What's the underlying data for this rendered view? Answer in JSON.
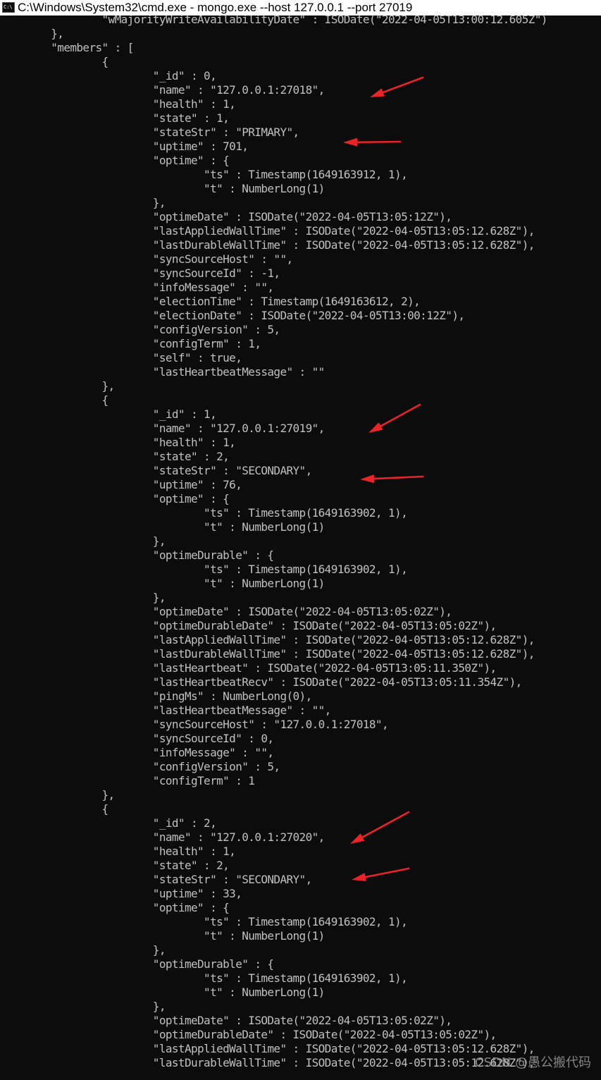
{
  "window": {
    "title": "C:\\Windows\\System32\\cmd.exe - mongo.exe  --host 127.0.0.1 --port 27019",
    "icon": "cmd-icon",
    "icon_text": "C:\\"
  },
  "console": {
    "lines": [
      "                \"wMajorityWriteAvailabilityDate\" : ISODate(\"2022-04-05T13:00:12.605Z\")",
      "        },",
      "        \"members\" : [",
      "                {",
      "                        \"_id\" : 0,",
      "                        \"name\" : \"127.0.0.1:27018\",",
      "                        \"health\" : 1,",
      "                        \"state\" : 1,",
      "                        \"stateStr\" : \"PRIMARY\",",
      "                        \"uptime\" : 701,",
      "                        \"optime\" : {",
      "                                \"ts\" : Timestamp(1649163912, 1),",
      "                                \"t\" : NumberLong(1)",
      "                        },",
      "                        \"optimeDate\" : ISODate(\"2022-04-05T13:05:12Z\"),",
      "                        \"lastAppliedWallTime\" : ISODate(\"2022-04-05T13:05:12.628Z\"),",
      "                        \"lastDurableWallTime\" : ISODate(\"2022-04-05T13:05:12.628Z\"),",
      "                        \"syncSourceHost\" : \"\",",
      "                        \"syncSourceId\" : -1,",
      "                        \"infoMessage\" : \"\",",
      "                        \"electionTime\" : Timestamp(1649163612, 2),",
      "                        \"electionDate\" : ISODate(\"2022-04-05T13:00:12Z\"),",
      "                        \"configVersion\" : 5,",
      "                        \"configTerm\" : 1,",
      "                        \"self\" : true,",
      "                        \"lastHeartbeatMessage\" : \"\"",
      "                },",
      "                {",
      "                        \"_id\" : 1,",
      "                        \"name\" : \"127.0.0.1:27019\",",
      "                        \"health\" : 1,",
      "                        \"state\" : 2,",
      "                        \"stateStr\" : \"SECONDARY\",",
      "                        \"uptime\" : 76,",
      "                        \"optime\" : {",
      "                                \"ts\" : Timestamp(1649163902, 1),",
      "                                \"t\" : NumberLong(1)",
      "                        },",
      "                        \"optimeDurable\" : {",
      "                                \"ts\" : Timestamp(1649163902, 1),",
      "                                \"t\" : NumberLong(1)",
      "                        },",
      "                        \"optimeDate\" : ISODate(\"2022-04-05T13:05:02Z\"),",
      "                        \"optimeDurableDate\" : ISODate(\"2022-04-05T13:05:02Z\"),",
      "                        \"lastAppliedWallTime\" : ISODate(\"2022-04-05T13:05:12.628Z\"),",
      "                        \"lastDurableWallTime\" : ISODate(\"2022-04-05T13:05:12.628Z\"),",
      "                        \"lastHeartbeat\" : ISODate(\"2022-04-05T13:05:11.350Z\"),",
      "                        \"lastHeartbeatRecv\" : ISODate(\"2022-04-05T13:05:11.354Z\"),",
      "                        \"pingMs\" : NumberLong(0),",
      "                        \"lastHeartbeatMessage\" : \"\",",
      "                        \"syncSourceHost\" : \"127.0.0.1:27018\",",
      "                        \"syncSourceId\" : 0,",
      "                        \"infoMessage\" : \"\",",
      "                        \"configVersion\" : 5,",
      "                        \"configTerm\" : 1",
      "                },",
      "                {",
      "                        \"_id\" : 2,",
      "                        \"name\" : \"127.0.0.1:27020\",",
      "                        \"health\" : 1,",
      "                        \"state\" : 2,",
      "                        \"stateStr\" : \"SECONDARY\",",
      "                        \"uptime\" : 33,",
      "                        \"optime\" : {",
      "                                \"ts\" : Timestamp(1649163902, 1),",
      "                                \"t\" : NumberLong(1)",
      "                        },",
      "                        \"optimeDurable\" : {",
      "                                \"ts\" : Timestamp(1649163902, 1),",
      "                                \"t\" : NumberLong(1)",
      "                        },",
      "                        \"optimeDate\" : ISODate(\"2022-04-05T13:05:02Z\"),",
      "                        \"optimeDurableDate\" : ISODate(\"2022-04-05T13:05:02Z\"),",
      "                        \"lastAppliedWallTime\" : ISODate(\"2022-04-05T13:05:12.628Z\"),",
      "                        \"lastDurableWallTime\" : ISODate(\"2022-04-05T13:05:12.628Z\"),"
    ]
  },
  "annotations": {
    "arrow_color": "#e8232a",
    "arrows": [
      "name-arrow",
      "statestr-arrow",
      "name-arrow",
      "statestr-arrow",
      "name-arrow",
      "statestr-arrow"
    ]
  },
  "watermark": {
    "text": "CSDN @愚公搬代码"
  },
  "colors": {
    "background": "#0c0c0c",
    "text": "#c0c0c0",
    "titlebar": "#ffffff"
  }
}
